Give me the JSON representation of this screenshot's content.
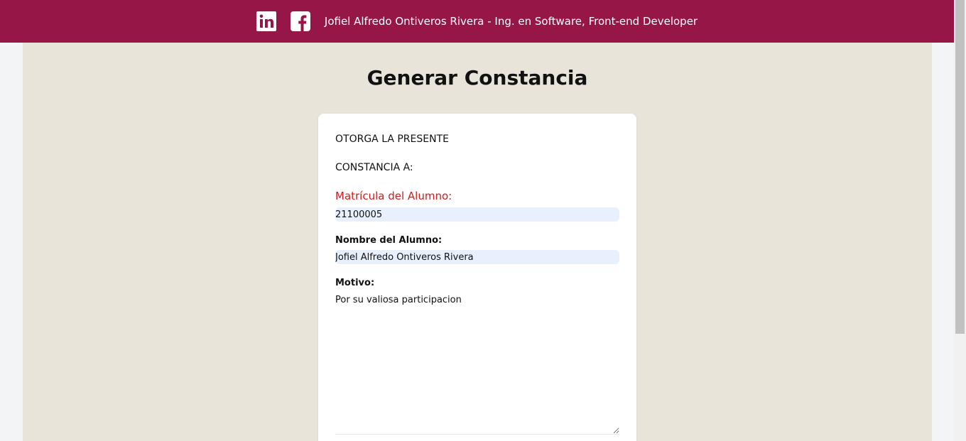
{
  "header": {
    "linkedin_icon": "linkedin-icon",
    "facebook_icon": "facebook-icon",
    "author": "Jofiel Alfredo Ontiveros Rivera - Ing. en Software, Front-end Developer",
    "bg_color": "#961648"
  },
  "page": {
    "title": "Generar Constancia",
    "bg_color": "#e8e4da"
  },
  "form": {
    "line1": "OTORGA LA PRESENTE",
    "line2": "CONSTANCIA A:",
    "matricula_label": "Matrícula del Alumno:",
    "matricula_value": "21100005",
    "nombre_label": "Nombre del Alumno:",
    "nombre_value": "Jofiel Alfredo Ontiveros Rivera",
    "motivo_label": "Motivo:",
    "motivo_value": "Por su valiosa participacion",
    "label_error_color": "#d11b1b"
  }
}
